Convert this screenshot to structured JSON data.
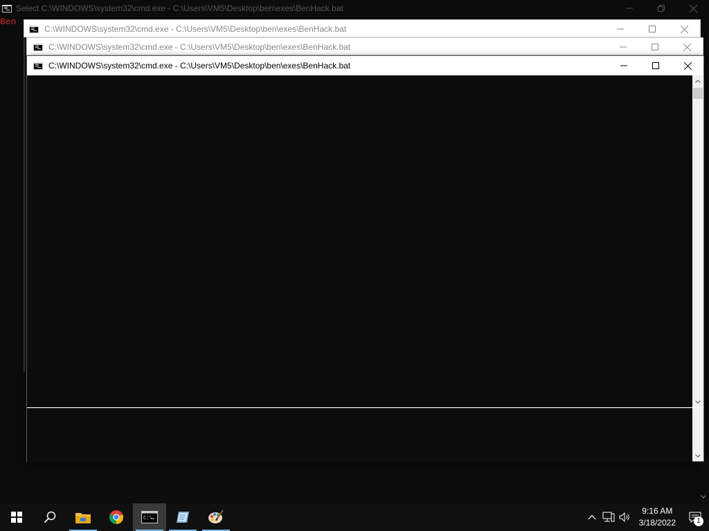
{
  "windows": {
    "background": {
      "title": "Select C:\\WINDOWS\\system32\\cmd.exe - C:\\Users\\VM5\\Desktop\\ben\\exes\\BenHack.bat",
      "console_text": "Ben"
    },
    "second": {
      "title": "C:\\WINDOWS\\system32\\cmd.exe - C:\\Users\\VM5\\Desktop\\ben\\exes\\BenHack.bat"
    },
    "third": {
      "title": "C:\\WINDOWS\\system32\\cmd.exe - C:\\Users\\VM5\\Desktop\\ben\\exes\\BenHack.bat"
    },
    "main": {
      "title": "C:\\WINDOWS\\system32\\cmd.exe - C:\\Users\\VM5\\Desktop\\ben\\exes\\BenHack.bat"
    }
  },
  "taskbar": {
    "pinned": [
      "start-icon",
      "search-icon",
      "file-explorer-icon",
      "chrome-icon",
      "command-prompt-icon",
      "notepad-icon",
      "paint-icon"
    ],
    "clock": {
      "time": "9:16 AM",
      "date": "3/18/2022"
    },
    "notification_count": "1"
  },
  "colors": {
    "console_bg": "#0c0c0c",
    "taskbar_bg": "#101010",
    "accent": "#76b9ed",
    "background_text": "#c62828"
  }
}
